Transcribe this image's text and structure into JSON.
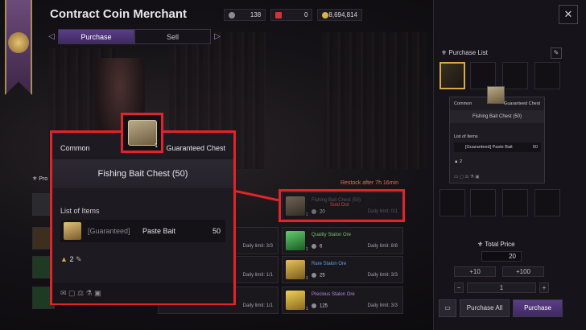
{
  "header": {
    "title": "Contract Coin Merchant",
    "currencies": [
      {
        "name": "silver-coin",
        "value": "138"
      },
      {
        "name": "ticket",
        "value": "0"
      },
      {
        "name": "gold",
        "value": "8,694,814"
      }
    ],
    "close": "✕"
  },
  "tabs": {
    "purchase": "Purchase",
    "sell": "Sell",
    "left_arrow": "◁",
    "right_arrow": "▷"
  },
  "store": {
    "header_label": "Pro",
    "restock": "Restock after  7h 16min",
    "items": [
      {
        "name": "Fishing Bait Chest (50)",
        "price": "20",
        "limit": "Daily limit: 0/1",
        "qty": "1",
        "status": "Sold Out",
        "color": "#6b6873"
      },
      {
        "name": "Quality Stalon Ore",
        "price": "6",
        "limit": "Daily limit: 8/8",
        "qty": "1",
        "color": "#6fc56a"
      },
      {
        "name": "Rare Stalon Ore",
        "price": "25",
        "limit": "Daily limit: 3/3",
        "qty": "1",
        "color": "#5fa0e6"
      },
      {
        "name": "Precious Stalon Ore",
        "price": "125",
        "limit": "Daily limit: 3/3",
        "qty": "1",
        "color": "#b58ae2"
      }
    ],
    "mid_limits": [
      "Daily limit: 3/3",
      "Daily limit: 1/1",
      "Daily limit: 1/1"
    ]
  },
  "tooltip": {
    "rarity": "Common",
    "tag": "Guaranteed Chest",
    "name": "Fishing Bait Chest (50)",
    "count": "1",
    "list_label": "List of Items",
    "entry_label": "[Guaranteed]",
    "entry_name": "Paste Bait",
    "entry_qty": "50",
    "stack_count": "2"
  },
  "purchase_list": {
    "title": "Purchase List",
    "mini_tooltip": {
      "rarity": "Common",
      "tag": "Guaranteed Chest",
      "name": "Fishing Bait Chest (50)",
      "list_label": "List of Items",
      "entry": "[Guaranteed] Paste Bait",
      "entry_qty": "50",
      "stack_count": "2"
    }
  },
  "footer": {
    "total_label": "Total Price",
    "total_value": "20",
    "plus10": "+10",
    "plus100": "+100",
    "minus": "−",
    "plus": "+",
    "quantity": "1",
    "purchase_all": "Purchase All",
    "purchase": "Purchase"
  }
}
